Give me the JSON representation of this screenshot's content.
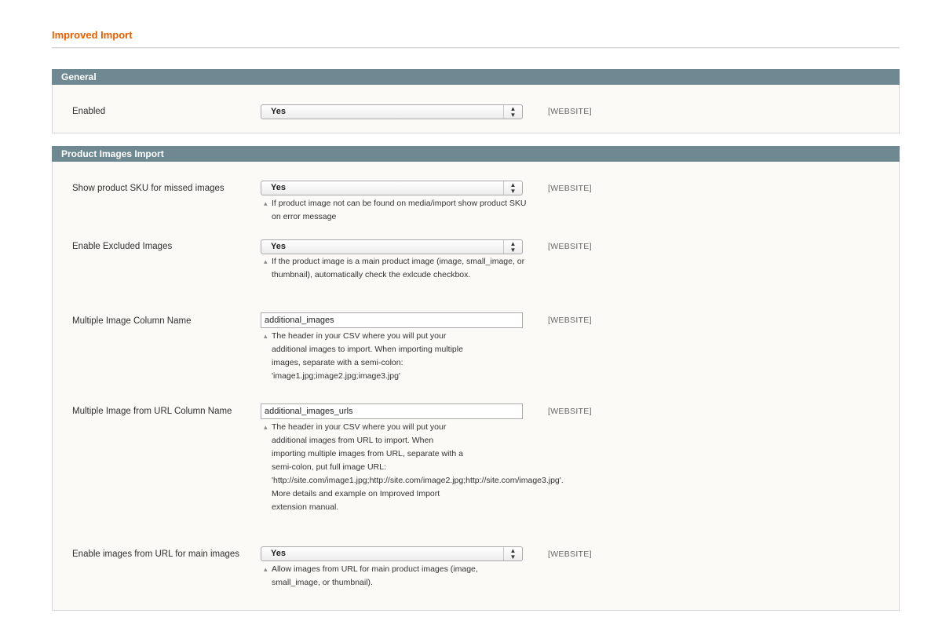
{
  "page": {
    "title": "Improved Import"
  },
  "sections": {
    "general": {
      "title": "General",
      "rows": [
        {
          "label": "Enabled",
          "value": "Yes",
          "scope": "[WEBSITE]"
        }
      ]
    },
    "product_images": {
      "title": "Product Images Import",
      "rows": [
        {
          "label": "Show product SKU for missed images",
          "value": "Yes",
          "scope": "[WEBSITE]",
          "note": "If product image not can be found on media/import show product SKU on error message"
        },
        {
          "label": "Enable Excluded Images",
          "value": "Yes",
          "scope": "[WEBSITE]",
          "note": "If the product image is a main product image (image, small_image, or thumbnail), automatically check the exlcude checkbox."
        },
        {
          "label": "Multiple Image Column Name",
          "value": "additional_images",
          "scope": "[WEBSITE]",
          "note_lines": [
            "The header in your CSV where you will put your",
            "additional images to import. When importing multiple",
            "images, separate with a semi-colon:",
            "'image1.jpg;image2.jpg;image3.jpg'"
          ]
        },
        {
          "label": "Multiple Image from URL Column Name",
          "value": "additional_images_urls",
          "scope": "[WEBSITE]",
          "note_lines": [
            "The header in your CSV where you will put your",
            "additional images from URL to import. When",
            "importing multiple images from URL, separate with a",
            "semi-colon, put full image URL:",
            "'http://site.com/image1.jpg;http://site.com/image2.jpg;http://site.com/image3.jpg'.",
            "More details and example on Improved Import",
            "extension manual."
          ]
        },
        {
          "label": "Enable images from URL for main images",
          "value": "Yes",
          "scope": "[WEBSITE]",
          "note": "Allow images from URL for main product images (image, small_image, or thumbnail)."
        }
      ]
    }
  },
  "icons": {
    "select_arrows": "updown-arrows-icon",
    "note_bullet": "note-bullet-icon"
  },
  "colors": {
    "title": "#eb5e00",
    "section_header": "#6f8992"
  }
}
